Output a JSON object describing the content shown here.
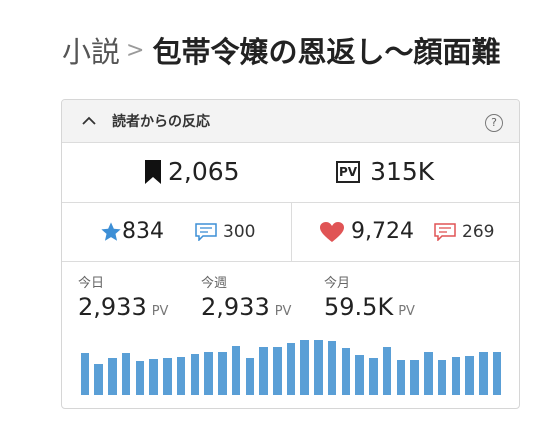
{
  "breadcrumb": {
    "parent": "小説",
    "separator": ">",
    "title": "包帯令嬢の恩返し〜顔面難"
  },
  "panel": {
    "title": "読者からの反応",
    "help": "?"
  },
  "row1": {
    "bookmarks": "2,065",
    "pv_icon": "PV",
    "pv": "315K"
  },
  "row2": {
    "stars": "834",
    "comments_blue": "300",
    "hearts": "9,724",
    "comments_red": "269"
  },
  "stats": {
    "unit": "PV",
    "today": {
      "label": "今日",
      "value": "2,933"
    },
    "week": {
      "label": "今週",
      "value": "2,933"
    },
    "month": {
      "label": "今月",
      "value": "59.5K"
    }
  },
  "colors": {
    "star": "#3d8fd6",
    "heart": "#e05455",
    "bar": "#5a9fd6",
    "comment_blue": "#3d8fd6",
    "comment_red": "#e05455"
  },
  "chart_data": {
    "type": "bar",
    "series": [
      {
        "values": [
          46,
          34,
          40,
          45,
          37,
          39,
          40,
          41,
          44,
          47,
          47,
          53,
          40,
          52,
          52,
          56,
          60,
          60,
          58,
          51,
          43,
          40,
          52,
          38,
          38,
          47,
          38,
          41,
          42,
          47,
          47
        ]
      }
    ],
    "ylim": [
      0,
      65
    ]
  }
}
